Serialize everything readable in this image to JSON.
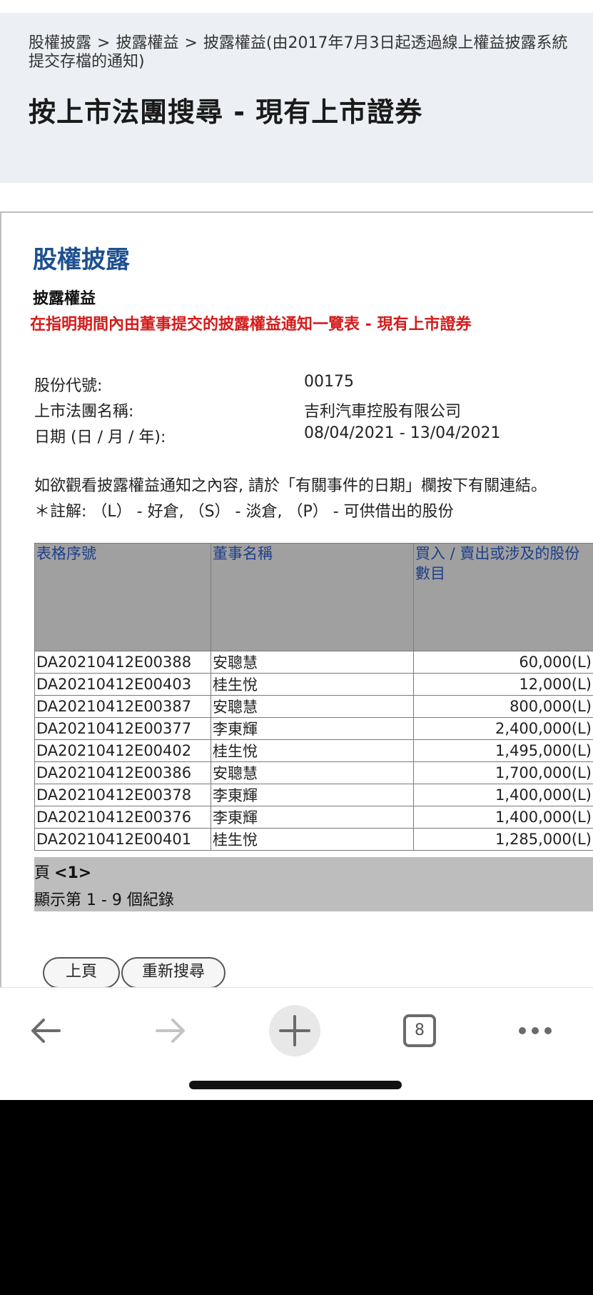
{
  "breadcrumb": {
    "item1": "股權披露",
    "item2": "披露權益",
    "item3": "披露權益(由2017年7月3日起透過線上權益披露系統提交存檔的通知)",
    "separator": ">"
  },
  "page_title": "按上市法團搜尋 - 現有上市證券",
  "section_title": "股權披露",
  "subsection_title": "披露權益",
  "red_title": "在指明期間內由董事提交的披露權益通知一覽表 - 現有上市證券",
  "info": {
    "stock_code_label": "股份代號:",
    "stock_code_value": "00175",
    "company_label": "上市法團名稱:",
    "company_value": "吉利汽車控股有限公司",
    "date_label": "日期 (日 / 月 / 年):",
    "date_value": "08/04/2021 - 13/04/2021"
  },
  "instructions": "如欲觀看披露權益通知之內容, 請於「有關事件的日期」欄按下有關連結。",
  "note": "＊註解: （L） - 好倉, （S） - 淡倉, （P） - 可供借出的股份",
  "table": {
    "headers": [
      "表格序號",
      "董事名稱",
      "買入 / 賣出或涉及的股份數目"
    ],
    "rows": [
      {
        "form": "DA20210412E00388",
        "director": "安聰慧",
        "shares": "60,000(L)"
      },
      {
        "form": "DA20210412E00403",
        "director": "桂生悅",
        "shares": "12,000(L)"
      },
      {
        "form": "DA20210412E00387",
        "director": "安聰慧",
        "shares": "800,000(L)"
      },
      {
        "form": "DA20210412E00377",
        "director": "李東輝",
        "shares": "2,400,000(L)"
      },
      {
        "form": "DA20210412E00402",
        "director": "桂生悅",
        "shares": "1,495,000(L)"
      },
      {
        "form": "DA20210412E00386",
        "director": "安聰慧",
        "shares": "1,700,000(L)"
      },
      {
        "form": "DA20210412E00378",
        "director": "李東輝",
        "shares": "1,400,000(L)"
      },
      {
        "form": "DA20210412E00376",
        "director": "李東輝",
        "shares": "1,400,000(L)"
      },
      {
        "form": "DA20210412E00401",
        "director": "桂生悅",
        "shares": "1,285,000(L)"
      }
    ]
  },
  "pager": {
    "label": "頁",
    "page": "<1>",
    "records": "顯示第 1 - 9 個紀錄"
  },
  "buttons": {
    "prev": "上頁",
    "new_search": "重新搜尋"
  },
  "toolbar": {
    "tab_count": "8"
  },
  "colors": {
    "header_bg": "#eceff3",
    "section_title": "#1d4f91",
    "red_title": "#d51b1b",
    "table_header_bg": "#a0a0a0"
  },
  "icons": [
    "back-arrow-icon",
    "forward-arrow-icon",
    "plus-icon",
    "tabs-icon",
    "more-icon"
  ]
}
